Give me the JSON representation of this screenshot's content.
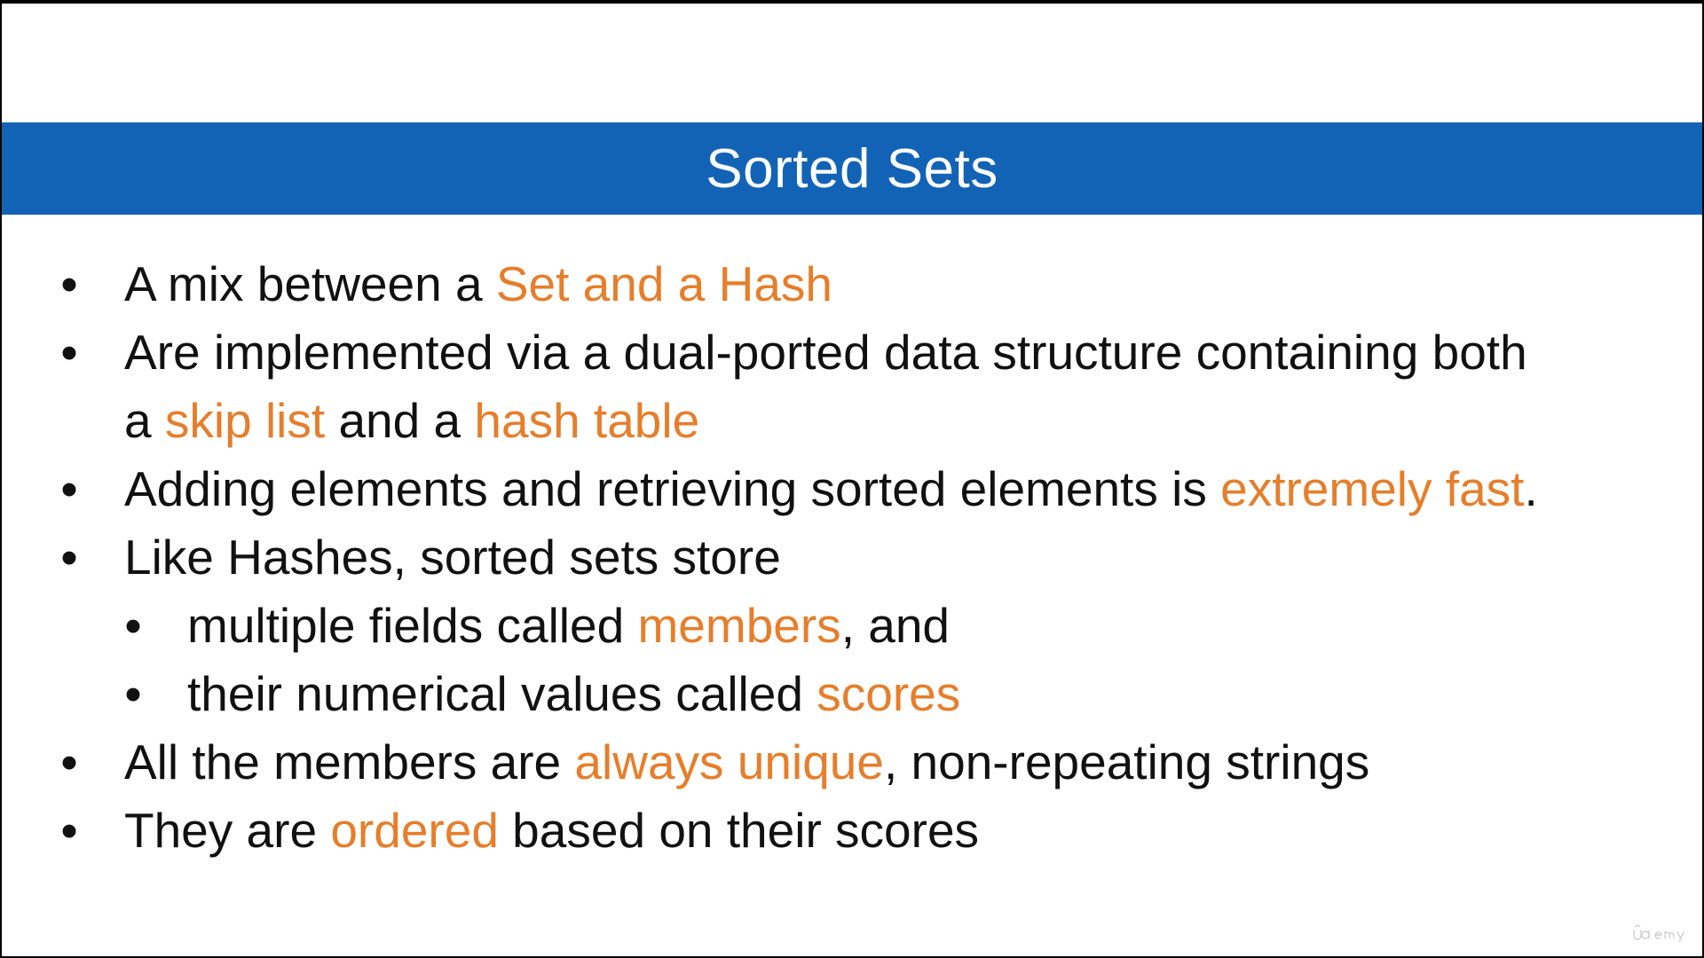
{
  "slide": {
    "title": "Sorted Sets",
    "colors": {
      "title_bar": "#1263b6",
      "highlight": "#e67e2b",
      "text": "#111111"
    },
    "bullets": [
      {
        "level": 0,
        "parts": [
          {
            "text": "A mix between a "
          },
          {
            "text": "Set and a Hash",
            "highlight": true
          }
        ]
      },
      {
        "level": 0,
        "line1": "Are implemented via a dual-ported data structure containing both",
        "line2_parts": [
          {
            "text": "a "
          },
          {
            "text": "skip list",
            "highlight": true
          },
          {
            "text": " and a "
          },
          {
            "text": "hash table",
            "highlight": true
          }
        ]
      },
      {
        "level": 0,
        "parts": [
          {
            "text": "Adding elements and retrieving sorted elements is "
          },
          {
            "text": "extremely fast",
            "highlight": true
          },
          {
            "text": "."
          }
        ]
      },
      {
        "level": 0,
        "parts": [
          {
            "text": "Like Hashes, sorted sets store"
          }
        ]
      },
      {
        "level": 1,
        "parts": [
          {
            "text": "multiple fields called "
          },
          {
            "text": "members",
            "highlight": true
          },
          {
            "text": ", and"
          }
        ]
      },
      {
        "level": 1,
        "parts": [
          {
            "text": "their numerical values called "
          },
          {
            "text": "scores",
            "highlight": true
          }
        ]
      },
      {
        "level": 0,
        "parts": [
          {
            "text": "All the members are "
          },
          {
            "text": "always unique",
            "highlight": true
          },
          {
            "text": ", non-repeating strings"
          }
        ]
      },
      {
        "level": 0,
        "parts": [
          {
            "text": "They are "
          },
          {
            "text": "ordered",
            "highlight": true
          },
          {
            "text": " based on their scores"
          }
        ]
      }
    ],
    "bullet_glyph": "•"
  },
  "watermark": {
    "logo": "udemy-logo"
  }
}
